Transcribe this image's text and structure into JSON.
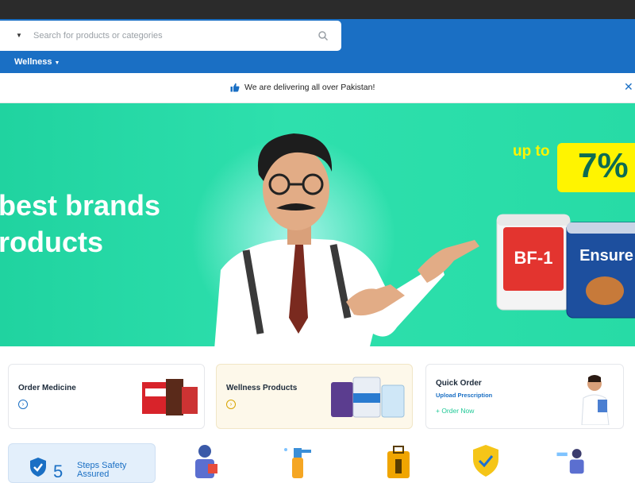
{
  "header": {
    "search_placeholder": "Search for products or categories",
    "nav": [
      {
        "label": "Wellness"
      }
    ]
  },
  "notice": {
    "text": "We are delivering all over Pakistan!"
  },
  "hero": {
    "headline_line1": "best brands",
    "headline_line2": "roducts",
    "promo_prefix": "up to",
    "promo_value": "7%",
    "product_1": "BF-1",
    "product_2": "Ensure",
    "slides": 9,
    "active_slide": 3
  },
  "cards": [
    {
      "title": "Order Medicine"
    },
    {
      "title": "Wellness Products"
    },
    {
      "title": "Quick Order",
      "subtitle": "Upload Prescription",
      "link": "+ Order Now"
    }
  ],
  "safety": {
    "number": "5",
    "line1": "Steps Safety",
    "line2": "Assured"
  },
  "colors": {
    "brand_blue": "#1a6fc4",
    "hero_green": "#2ee0ad",
    "promo_yellow": "#fff400"
  }
}
